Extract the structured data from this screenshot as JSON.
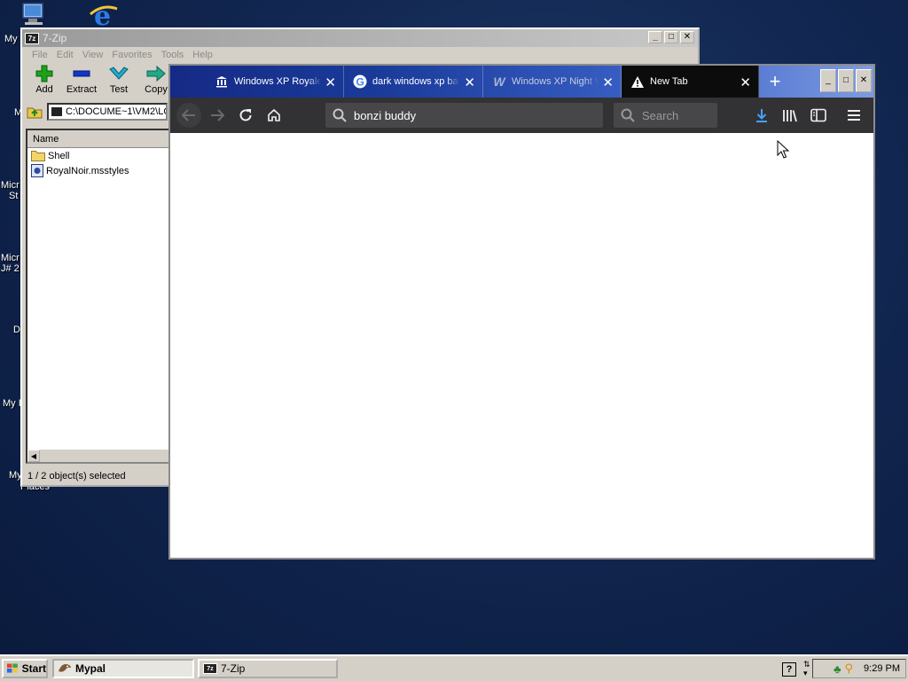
{
  "desktop": {
    "icons": [
      {
        "label": "My",
        "icon": "my-computer-icon"
      },
      {
        "label": "M",
        "icon": "my-documents-icon"
      },
      {
        "label": "Micr",
        "icon": "visual-studio-icon"
      },
      {
        "label": "St",
        "icon": "visual-studio-icon"
      },
      {
        "label": "Micr",
        "icon": "visual-j-icon"
      },
      {
        "label": "J# 2",
        "icon": "visual-j-icon"
      },
      {
        "label": "D",
        "icon": "recycle-bin-icon"
      },
      {
        "label": "My I",
        "icon": "network-icon"
      },
      {
        "label": "My",
        "icon": "network-places-icon"
      },
      {
        "label": "Places",
        "icon": "network-places-icon"
      }
    ]
  },
  "sevenzip": {
    "title": "7-Zip",
    "menu": [
      "File",
      "Edit",
      "View",
      "Favorites",
      "Tools",
      "Help"
    ],
    "toolbar": [
      {
        "label": "Add",
        "icon": "plus-icon",
        "color": "#1aa31a"
      },
      {
        "label": "Extract",
        "icon": "minus-icon",
        "color": "#1234c8"
      },
      {
        "label": "Test",
        "icon": "check-icon",
        "color": "#22aacc"
      },
      {
        "label": "Copy",
        "icon": "arrow-right-icon",
        "color": "#22aa88"
      }
    ],
    "address": "C:\\DOCUME~1\\VM2\\LO",
    "column_name": "Name",
    "files": [
      {
        "name": "Shell",
        "icon": "folder-icon"
      },
      {
        "name": "RoyalNoir.msstyles",
        "icon": "file-icon"
      }
    ],
    "status": "1 / 2 object(s) selected"
  },
  "browser": {
    "tabs": [
      {
        "label": "Windows XP Royale",
        "icon": "museum-icon",
        "active": false
      },
      {
        "label": "dark windows xp ba",
        "icon": "google-icon",
        "active": false
      },
      {
        "label": "Windows XP Night W",
        "icon": "w-logo-icon",
        "active": false
      },
      {
        "label": "New Tab",
        "icon": "warning-icon",
        "active": true
      }
    ],
    "url_text": "bonzi buddy",
    "search_placeholder": "Search"
  },
  "taskbar": {
    "start": "Start",
    "items": [
      {
        "label": "Mypal",
        "pressed": true
      },
      {
        "label": "7-Zip",
        "pressed": false
      }
    ],
    "clock": "9:29 PM"
  }
}
